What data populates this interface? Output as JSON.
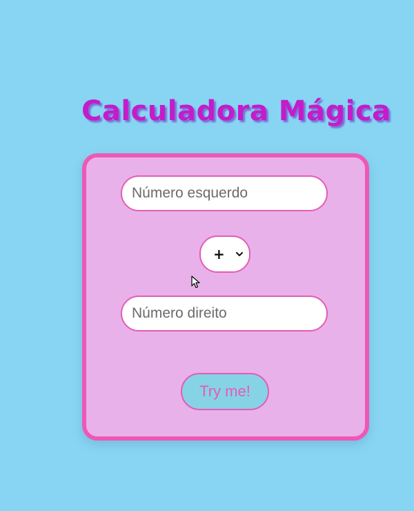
{
  "page": {
    "title": "Calculadora Mágica"
  },
  "calculator": {
    "left_input": {
      "placeholder": "Número esquerdo",
      "value": ""
    },
    "operator": {
      "selected": "+",
      "icon": "chevron-down-icon"
    },
    "right_input": {
      "placeholder": "Número direito",
      "value": ""
    },
    "submit_label": "Try me!"
  },
  "colors": {
    "background": "#87d5f3",
    "card_background": "#e8b1e9",
    "card_border": "#ef58b5",
    "title": "#c41cc9",
    "title_shadow": "#7a6fd6",
    "button_background": "#86d3e6",
    "accent": "#e45bb6"
  }
}
